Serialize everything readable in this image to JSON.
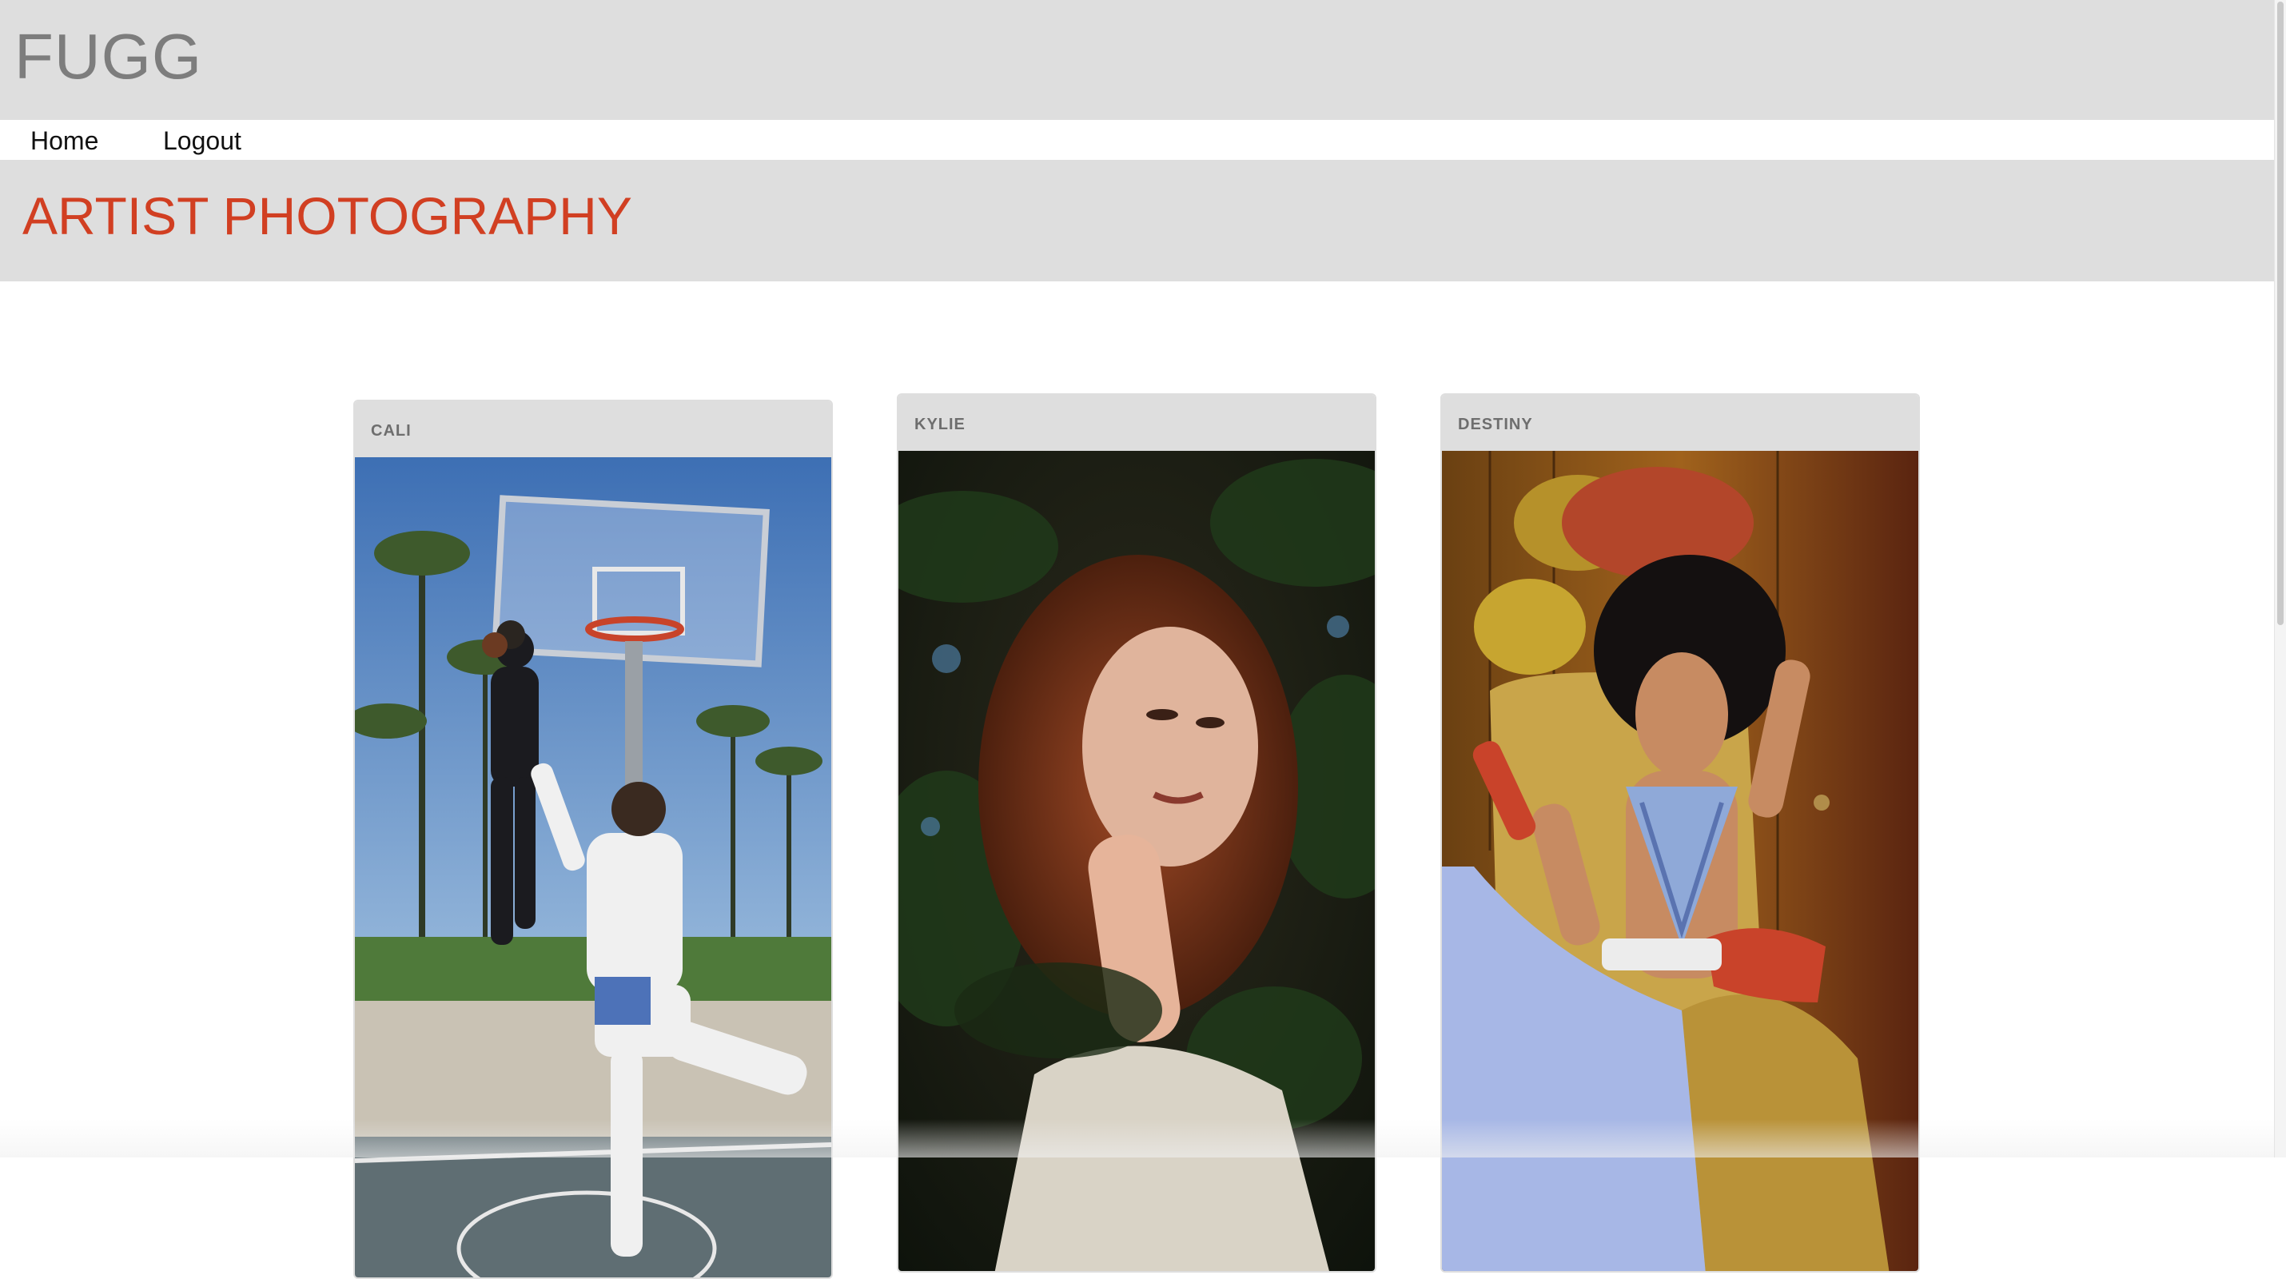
{
  "header": {
    "logo": "FUGG"
  },
  "nav": {
    "items": [
      {
        "label": "Home"
      },
      {
        "label": "Logout"
      }
    ]
  },
  "page": {
    "title": "ARTIST PHOTOGRAPHY"
  },
  "cards": [
    {
      "label": "CALI",
      "photo_icon": "basketball-dunk-photo"
    },
    {
      "label": "KYLIE",
      "photo_icon": "portrait-red-hair-photo"
    },
    {
      "label": "DESTINY",
      "photo_icon": "woman-with-phone-photo"
    }
  ],
  "colors": {
    "header_bg": "#dedede",
    "logo": "#7d7d7d",
    "title_accent": "#d13f22",
    "card_header_bg": "#dedede"
  }
}
